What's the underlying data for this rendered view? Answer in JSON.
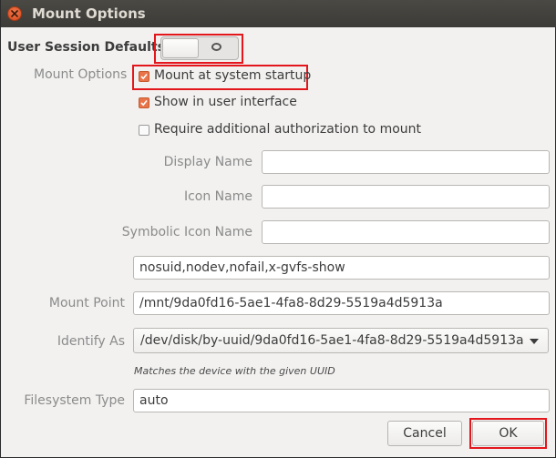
{
  "window": {
    "title": "Mount Options"
  },
  "defaults": {
    "label": "User Session Defaults",
    "switch_state_glyph": "O",
    "switch_on": false
  },
  "mount_options": {
    "section_label": "Mount Options",
    "checkboxes": [
      {
        "label": "Mount at system startup",
        "checked": true
      },
      {
        "label": "Show in user interface",
        "checked": true
      },
      {
        "label": "Require additional authorization to mount",
        "checked": false
      }
    ],
    "display_name": {
      "label": "Display Name",
      "value": ""
    },
    "icon_name": {
      "label": "Icon Name",
      "value": ""
    },
    "symbolic_icon_name": {
      "label": "Symbolic Icon Name",
      "value": ""
    },
    "options_value": "nosuid,nodev,nofail,x-gvfs-show",
    "mount_point": {
      "label": "Mount Point",
      "value": "/mnt/9da0fd16-5ae1-4fa8-8d29-5519a4d5913a"
    },
    "identify_as": {
      "label": "Identify As",
      "selected": "/dev/disk/by-uuid/9da0fd16-5ae1-4fa8-8d29-5519a4d5913a",
      "hint": "Matches the device with the given UUID"
    },
    "filesystem_type": {
      "label": "Filesystem Type",
      "value": "auto"
    }
  },
  "buttons": {
    "cancel": "Cancel",
    "ok": "OK"
  },
  "colors": {
    "highlight": "#e3161c",
    "checkbox_checked": "#e9744a",
    "titlebar": "#3c3b37"
  }
}
